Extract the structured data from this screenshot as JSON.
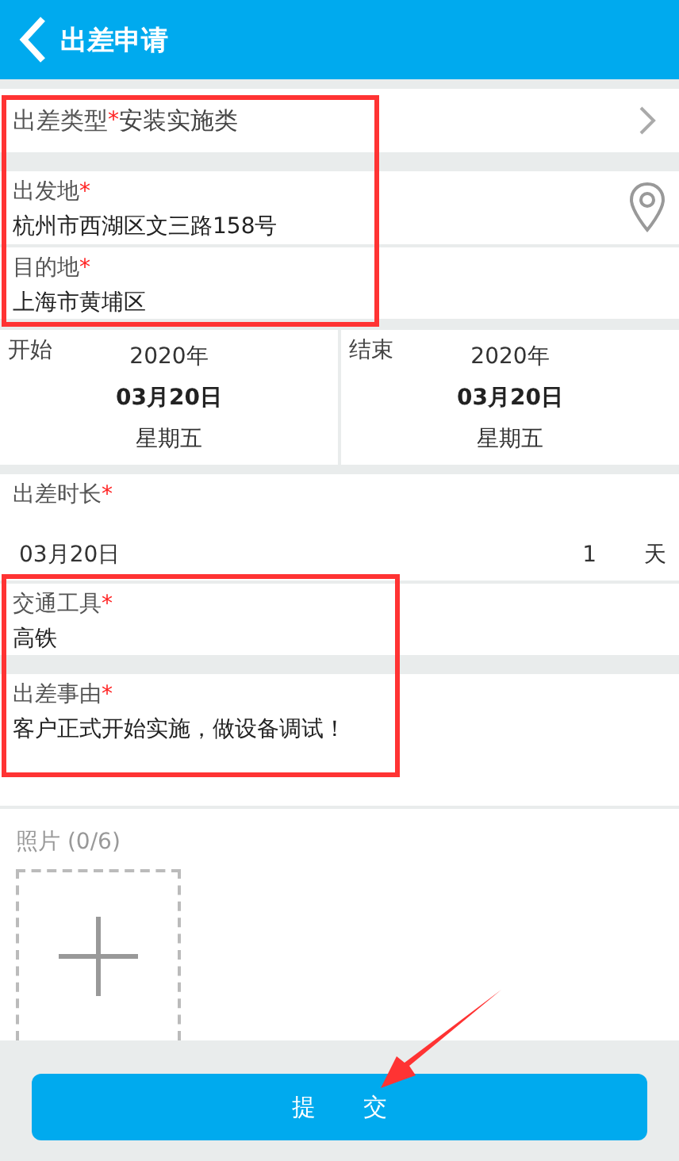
{
  "header": {
    "title": "出差申请"
  },
  "trip_type": {
    "label": "出差类型",
    "required_mark": "*",
    "value": "安装实施类"
  },
  "departure": {
    "label": "出发地",
    "required_mark": "*",
    "value": "杭州市西湖区文三路158号"
  },
  "destination": {
    "label": "目的地",
    "required_mark": "*",
    "value": "上海市黄埔区"
  },
  "dates": [
    {
      "label": "开始",
      "year": "2020年",
      "date": "03月20日",
      "weekday": "星期五"
    },
    {
      "label": "结束",
      "year": "2020年",
      "date": "03月20日",
      "weekday": "星期五"
    }
  ],
  "duration": {
    "label": "出差时长",
    "required_mark": "*",
    "date": "03月20日",
    "days": "1",
    "unit": "天"
  },
  "transport": {
    "label": "交通工具",
    "required_mark": "*",
    "value": "高铁"
  },
  "reason": {
    "label": "出差事由",
    "required_mark": "*",
    "value": "客户正式开始实施，做设备调试！"
  },
  "photos": {
    "label": "照片 (0/6)"
  },
  "submit": {
    "label": "提　　交"
  }
}
